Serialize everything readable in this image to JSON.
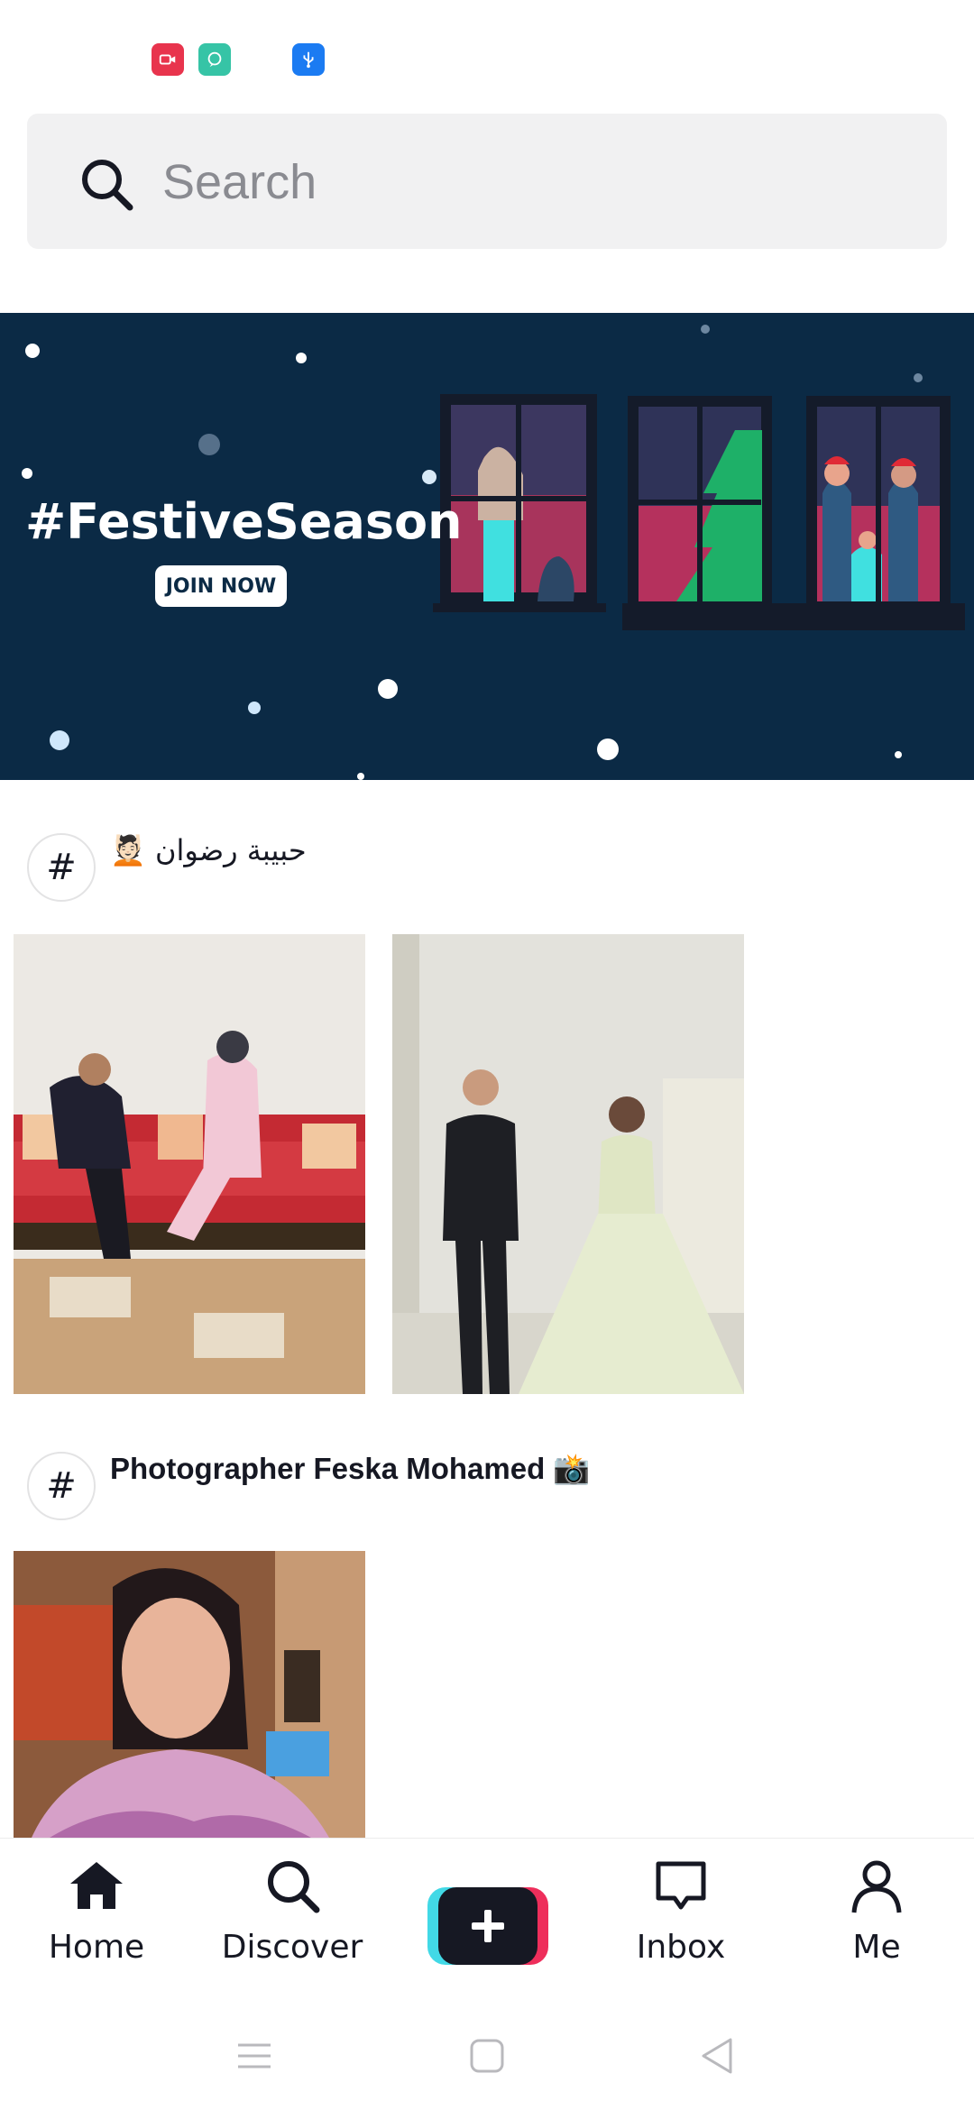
{
  "status_bar": {
    "icons": [
      "screen-record-icon",
      "chat-bubble-icon",
      "usb-icon"
    ],
    "colors": {
      "record": "#e8344d",
      "chat": "#36c4a6",
      "usb": "#1b7bf2"
    }
  },
  "search": {
    "placeholder": "Search"
  },
  "banner": {
    "title": "#FestiveSeason",
    "button_label": "JOIN NOW",
    "background_color": "#0b2a45"
  },
  "sections": [
    {
      "hashtag_symbol": "#",
      "label": "💆🏻 حبيبة رضوان",
      "videos": [
        "couple-on-sofa-thumbnail",
        "wedding-couple-thumbnail"
      ]
    },
    {
      "hashtag_symbol": "#",
      "label": "Photographer Feska Mohamed 📸",
      "videos": [
        "woman-portrait-thumbnail"
      ]
    }
  ],
  "bottom_nav": {
    "items": [
      {
        "label": "Home",
        "icon": "home-icon"
      },
      {
        "label": "Discover",
        "icon": "search-icon"
      },
      {
        "label": "",
        "icon": "plus-icon"
      },
      {
        "label": "Inbox",
        "icon": "message-icon"
      },
      {
        "label": "Me",
        "icon": "profile-icon"
      }
    ],
    "create_colors": {
      "left": "#42d9e6",
      "right": "#ee2e5b",
      "front": "#161823"
    }
  },
  "system_nav": {
    "buttons": [
      "menu-icon",
      "home-square-icon",
      "back-triangle-icon"
    ]
  }
}
